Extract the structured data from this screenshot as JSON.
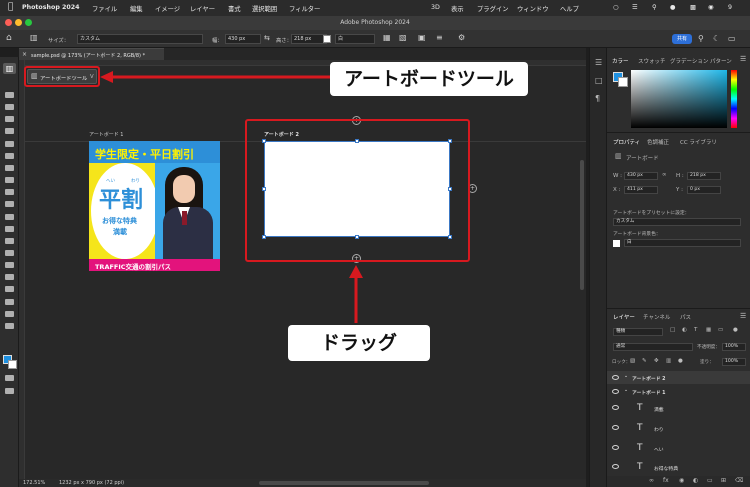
{
  "menubar": {
    "app_name": "Photoshop 2024",
    "items": [
      "ファイル",
      "編集",
      "イメージ",
      "レイヤー",
      "書式",
      "選択範囲",
      "フィルター"
    ],
    "right_items": [
      "3D",
      "表示",
      "プラグイン",
      "ウィンドウ",
      "ヘルプ"
    ],
    "clock": "9"
  },
  "window": {
    "title": "Adobe Photoshop 2024"
  },
  "options": {
    "size_label": "サイズ：",
    "size_value": "カスタム",
    "width_label": "幅：",
    "width_value": "430 px",
    "height_label": "高さ：",
    "height_value": "218 px",
    "bg_value": "白",
    "share_button": "共有"
  },
  "document_tab": {
    "title": "sample.psd @ 173% (アートボード 2, RGB/8) *"
  },
  "tool_tooltip": {
    "label": "アートボードツール",
    "shortcut": "V"
  },
  "artboards": {
    "ab1_label": "アートボード 1",
    "ab2_label": "アートボード 2"
  },
  "banner": {
    "headline": "学生限定・平日割引",
    "big_text": "平割",
    "ruby_left": "へい",
    "ruby_right": "わり",
    "sub1": "お得な特典",
    "sub2": "満載",
    "footer": "TRAFFIC交通の割引パス"
  },
  "callouts": {
    "artboard_tool": "アートボードツール",
    "drag": "ドラッグ"
  },
  "status": {
    "zoom": "172.51%",
    "doc_size": "1232 px x 790 px (72 ppi)"
  },
  "color_panel": {
    "tabs": [
      "カラー",
      "スウォッチ",
      "グラデーション",
      "パターン"
    ]
  },
  "properties_panel": {
    "tabs": [
      "プロパティ",
      "色調補正",
      "CC ライブラリ"
    ],
    "section_title": "アートボード",
    "w_label": "W :",
    "w_value": "430 px",
    "h_label": "H :",
    "h_value": "218 px",
    "x_label": "X :",
    "x_value": "411 px",
    "y_label": "Y :",
    "y_value": "0 px",
    "preset_label": "アートボードをプリセットに設定：",
    "preset_value": "カスタム",
    "bg_label": "アートボード背景色：",
    "bg_value": "白"
  },
  "layers_panel": {
    "tabs": [
      "レイヤー",
      "チャンネル",
      "パス"
    ],
    "filter_value": "種類",
    "blend_value": "通常",
    "opacity_label": "不透明度：",
    "opacity_value": "100%",
    "lock_label": "ロック：",
    "fill_label": "塗り：",
    "fill_value": "100%",
    "rows": [
      {
        "name": "アートボード 2",
        "kind": "group"
      },
      {
        "name": "アートボード 1",
        "kind": "group"
      },
      {
        "name": "満載",
        "kind": "text"
      },
      {
        "name": "わり",
        "kind": "text"
      },
      {
        "name": "へい",
        "kind": "text"
      },
      {
        "name": "お得な特典",
        "kind": "text"
      }
    ]
  },
  "colors": {
    "accent_red": "#d7191f",
    "selection_blue": "#3b78c4",
    "banner_yellow": "#f5e51b",
    "banner_blue": "#2d8fd8",
    "banner_pink": "#e3137c"
  }
}
